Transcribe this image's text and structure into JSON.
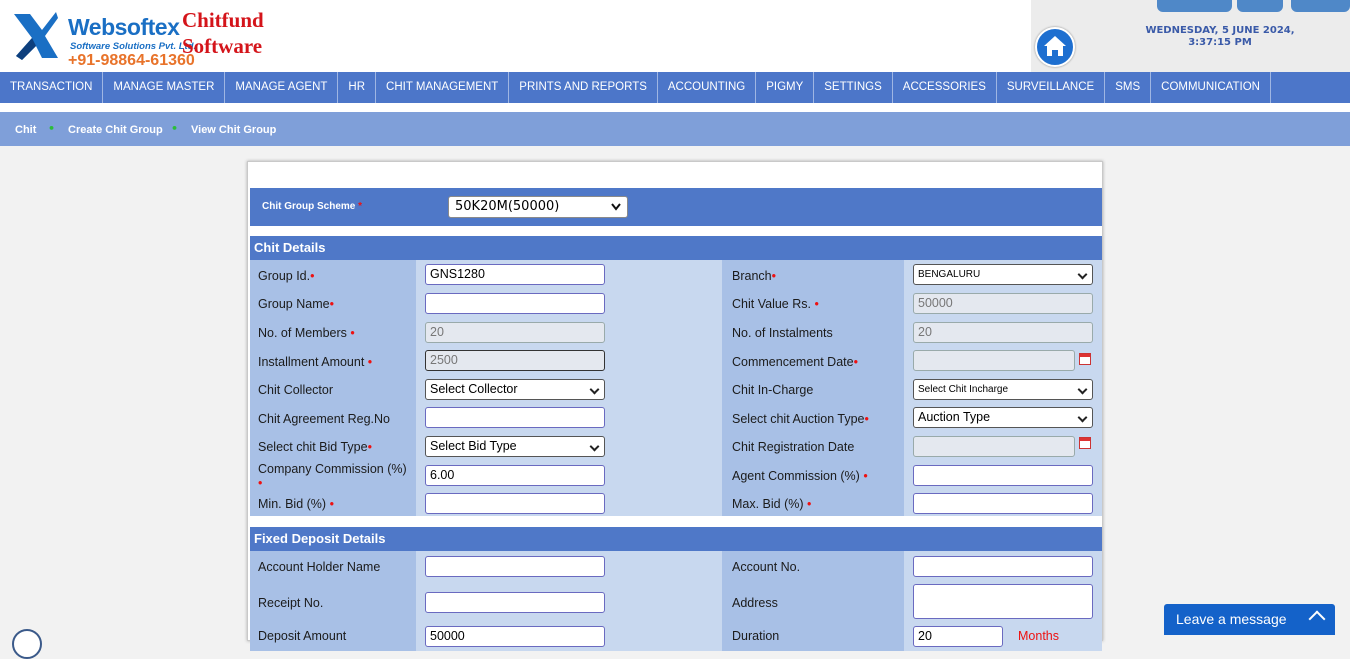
{
  "brand": {
    "name": "Websoftex",
    "sub": "Software Solutions Pvt. Ltd.",
    "phone": "+91-98864-61360",
    "title_line1": "Chitfund",
    "title_line2": "Software"
  },
  "datetime": {
    "date": "WEDNESDAY, 5 JUNE 2024,",
    "time": "3:37:15 PM"
  },
  "nav": [
    "TRANSACTION",
    "MANAGE MASTER",
    "MANAGE AGENT",
    "HR",
    "CHIT MANAGEMENT",
    "PRINTS AND REPORTS",
    "ACCOUNTING",
    "PIGMY",
    "SETTINGS",
    "ACCESSORIES",
    "SURVEILLANCE",
    "SMS",
    "COMMUNICATION"
  ],
  "breadcrumb": [
    "Chit",
    "Create Chit Group",
    "View Chit Group"
  ],
  "scheme": {
    "label": "Chit Group Scheme",
    "value": "50K20M(50000)"
  },
  "chit_details": {
    "heading": "Chit Details",
    "group_id": {
      "label": "Group Id.",
      "value": "GNS1280"
    },
    "group_name": {
      "label": "Group Name",
      "value": ""
    },
    "members": {
      "label": "No. of Members",
      "value": "20"
    },
    "installment": {
      "label": "Installment Amount",
      "value": "2500"
    },
    "collector": {
      "label": "Chit Collector",
      "value": "Select Collector"
    },
    "agreement": {
      "label": "Chit Agreement Reg.No",
      "value": ""
    },
    "bid_type": {
      "label": "Select chit Bid Type",
      "value": "Select Bid Type"
    },
    "company_commission": {
      "label": "Company Commission (%)",
      "value": "6.00"
    },
    "min_bid": {
      "label": "Min. Bid (%)",
      "value": ""
    },
    "branch": {
      "label": "Branch",
      "value": "BENGALURU"
    },
    "chit_value": {
      "label": "Chit Value Rs.",
      "value": "50000"
    },
    "instalments": {
      "label": "No. of Instalments",
      "value": "20"
    },
    "commencement": {
      "label": "Commencement Date",
      "value": ""
    },
    "incharge": {
      "label": "Chit In-Charge",
      "value": "Select Chit Incharge"
    },
    "auction_type": {
      "label": "Select chit Auction Type",
      "value": "Auction Type"
    },
    "registration_date": {
      "label": "Chit Registration Date",
      "value": ""
    },
    "agent_commission": {
      "label": "Agent Commission (%)",
      "value": ""
    },
    "max_bid": {
      "label": "Max. Bid (%)",
      "value": ""
    }
  },
  "fixed_deposit": {
    "heading": "Fixed Deposit Details",
    "holder": {
      "label": "Account Holder Name",
      "value": ""
    },
    "receipt": {
      "label": "Receipt No.",
      "value": ""
    },
    "deposit_amount": {
      "label": "Deposit Amount",
      "value": "50000"
    },
    "account_no": {
      "label": "Account No.",
      "value": ""
    },
    "address": {
      "label": "Address",
      "value": ""
    },
    "duration": {
      "label": "Duration",
      "value": "20",
      "unit": "Months"
    }
  },
  "chat": {
    "label": "Leave a message"
  },
  "colors": {
    "nav": "#4c76c9",
    "section": "#4f78c8",
    "label_cell": "#a8c0e6",
    "value_cell": "#c8d8ef",
    "required": "#e11111"
  }
}
